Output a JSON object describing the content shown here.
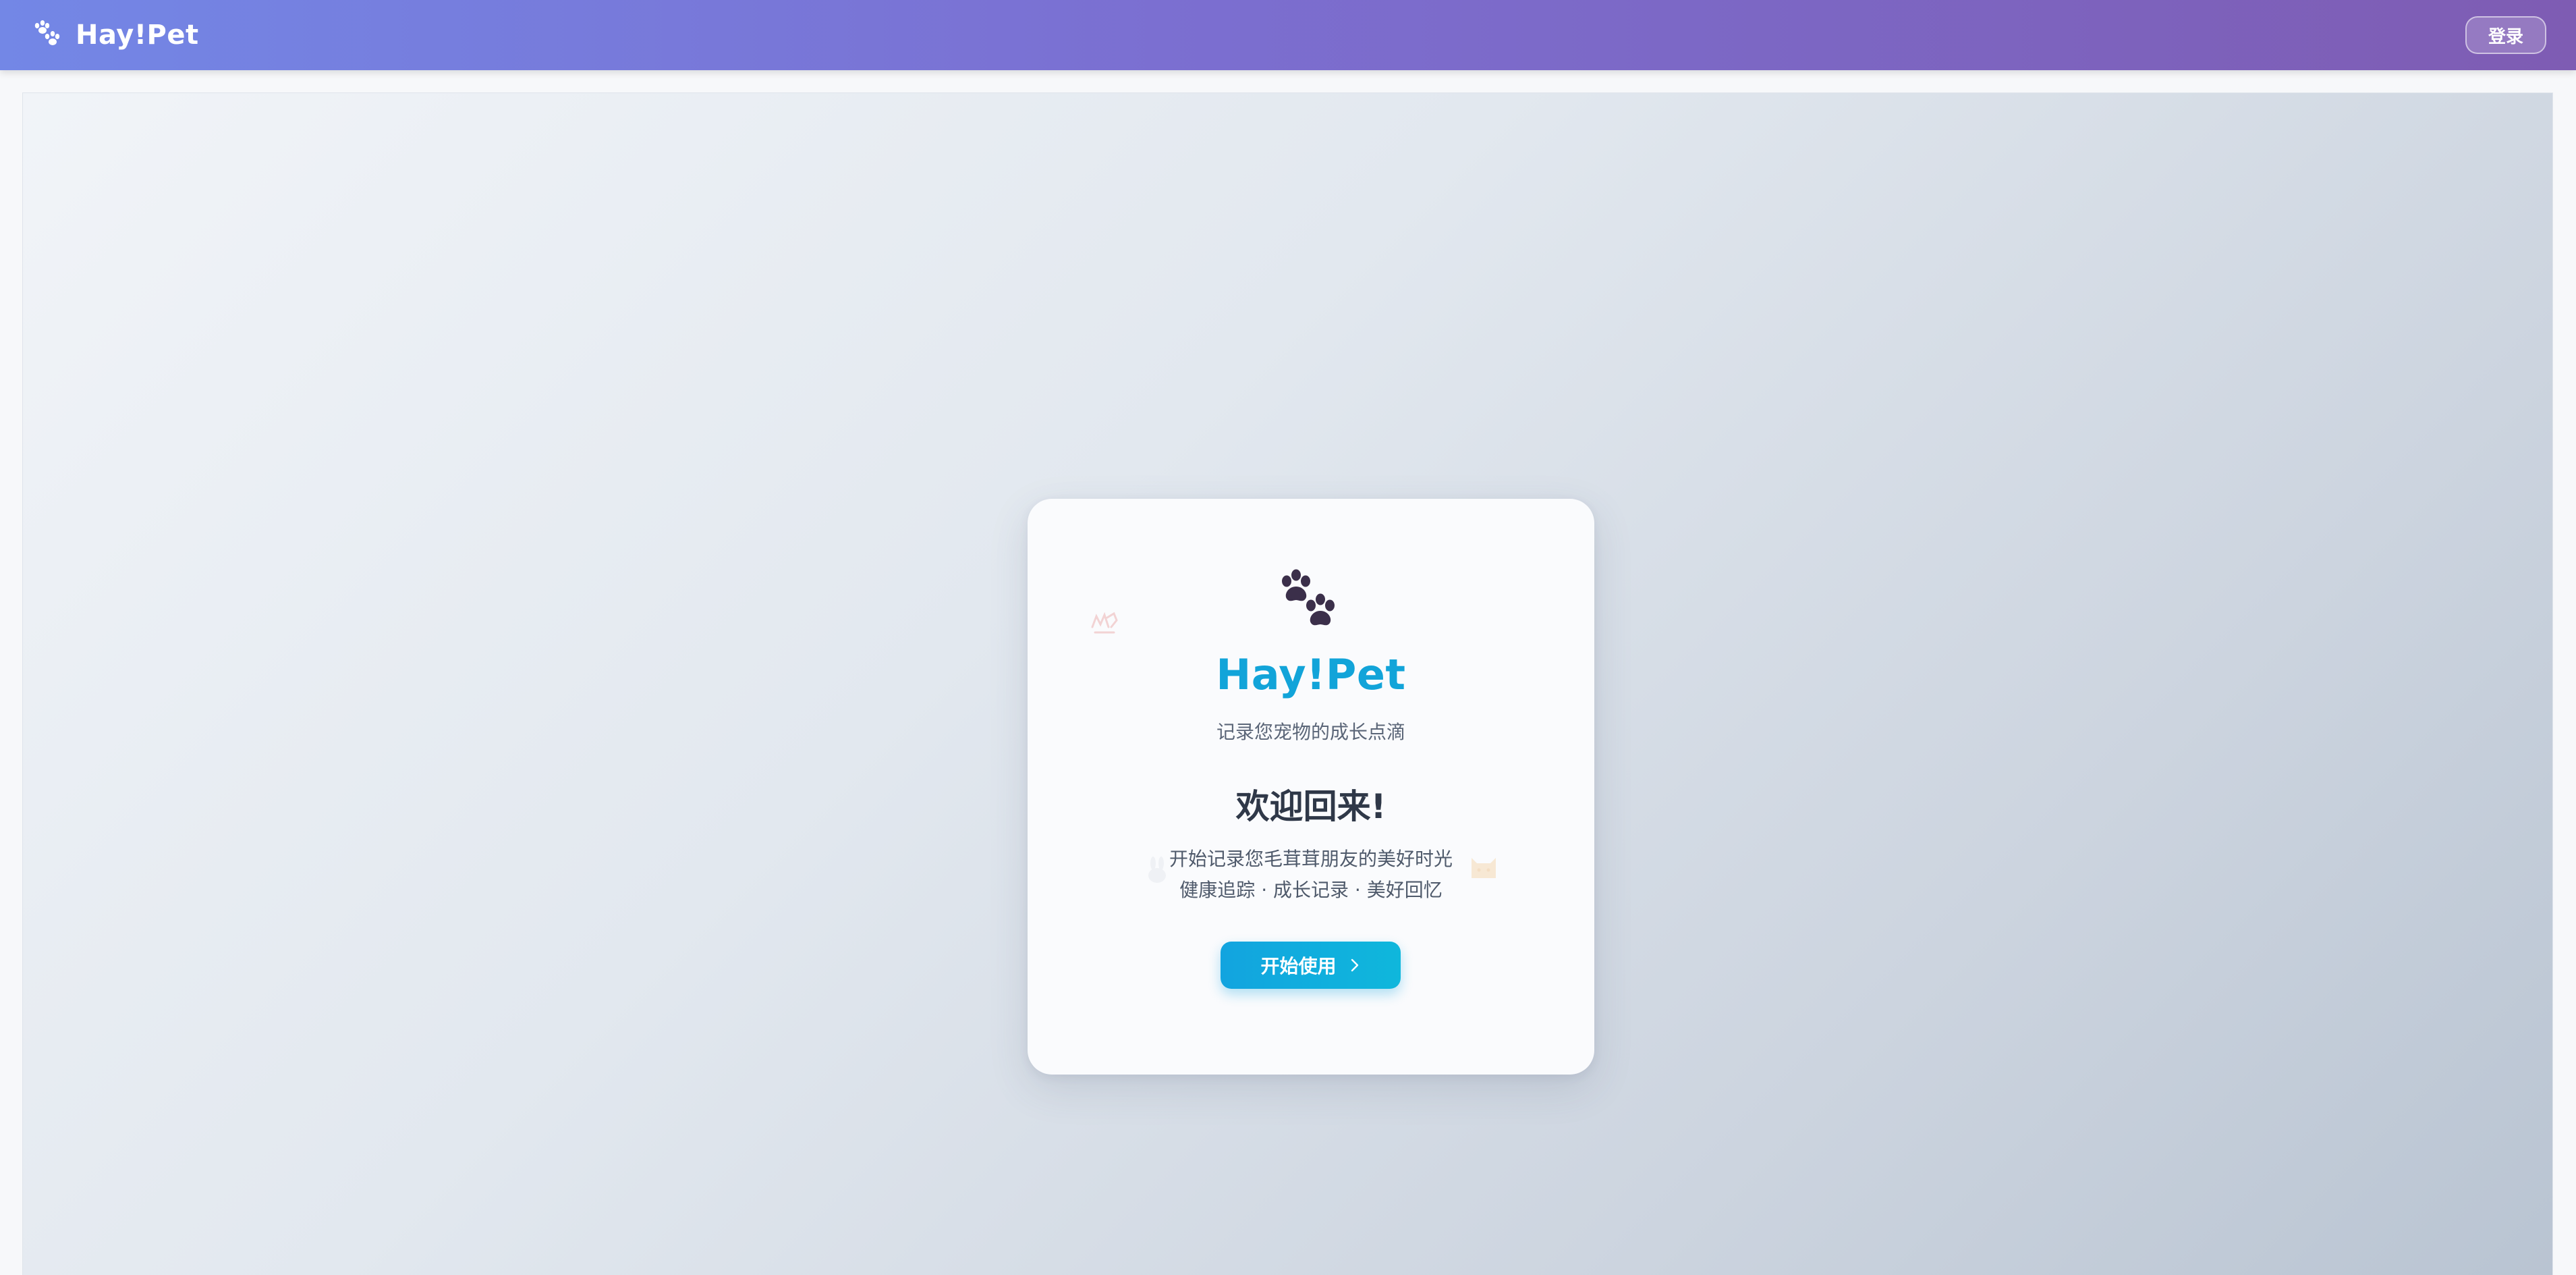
{
  "header": {
    "app_name": "Hay!Pet",
    "logo_icon": "paw-icon",
    "login_label": "登录"
  },
  "card": {
    "icon": "paw-icon",
    "title": "Hay!Pet",
    "subtitle": "记录您宠物的成长点滴",
    "welcome": "欢迎回来!",
    "description_line1": "开始记录您毛茸茸朋友的美好时光",
    "description_line2": "健康追踪 · 成长记录 · 美好回忆",
    "start_button_label": "开始使用",
    "start_button_icon": "chevron-right-icon",
    "decorations": [
      "dog-icon",
      "cat-icon",
      "bunny-icon"
    ]
  },
  "colors": {
    "header_gradient_start": "#7387e6",
    "header_gradient_end": "#7e5cb3",
    "title_color": "#12a4d9",
    "button_color": "#12a4df",
    "paw_color": "#3b2f4a"
  }
}
